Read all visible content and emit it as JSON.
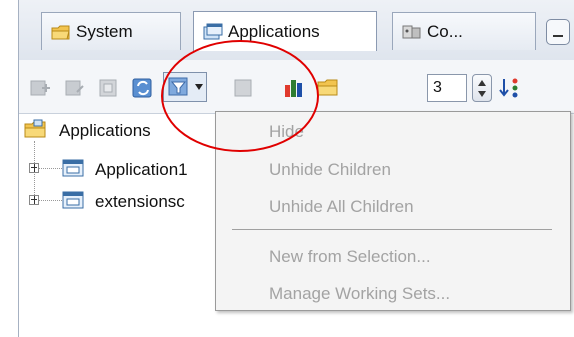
{
  "tabs": {
    "system_label": "System",
    "applications_label": "Applications",
    "co_label": "Co..."
  },
  "toolbar": {
    "working_set_value": "3"
  },
  "tree": {
    "root_label": "Applications",
    "items": [
      {
        "label": "Application1"
      },
      {
        "label": "extensionsc"
      }
    ]
  },
  "menu": {
    "items": [
      {
        "label": "Hide"
      },
      {
        "label": "Unhide Children"
      },
      {
        "label": "Unhide All Children"
      },
      {
        "label": "New from Selection..."
      },
      {
        "label": "Manage Working Sets..."
      }
    ]
  },
  "colors": {
    "annotation": "#e00000",
    "disabled_text": "#a3a3a3"
  }
}
